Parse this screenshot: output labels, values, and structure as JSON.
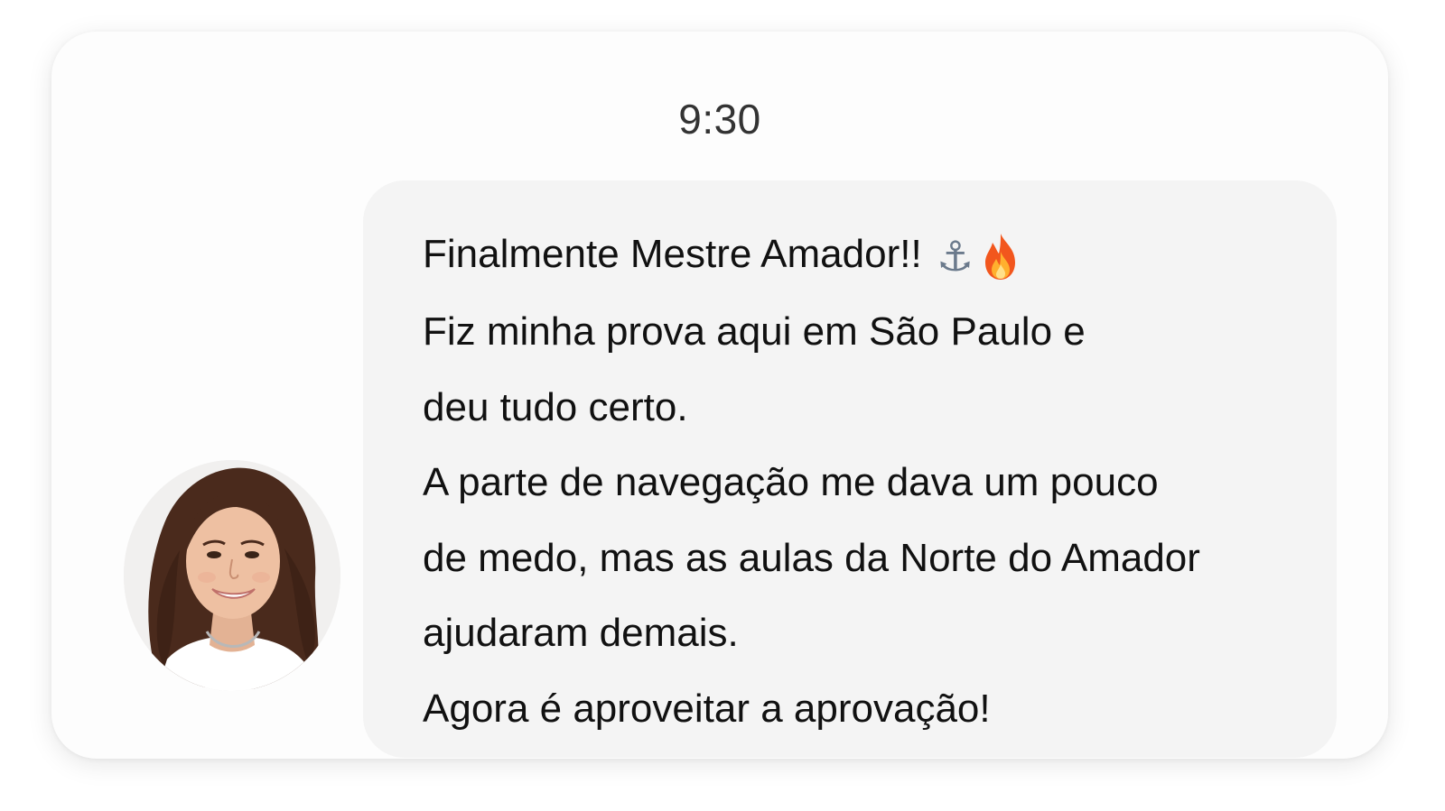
{
  "message": {
    "time": "9:30",
    "lines": [
      "Finalmente Mestre Amador!!",
      "Fiz minha prova aqui em São Paulo e",
      "deu tudo certo.",
      "A parte de navegação me dava um pouco",
      "de medo, mas as aulas da Norte do Amador",
      "ajudaram demais.",
      "Agora é aproveitar a aprovação!"
    ],
    "emojis": [
      "anchor-icon",
      "fire-icon"
    ]
  },
  "avatar": {
    "icon": "user-photo"
  },
  "colors": {
    "card_background": "#fdfdfd",
    "bubble_background": "#f4f4f4",
    "text": "#111111",
    "timestamp": "#333333"
  }
}
